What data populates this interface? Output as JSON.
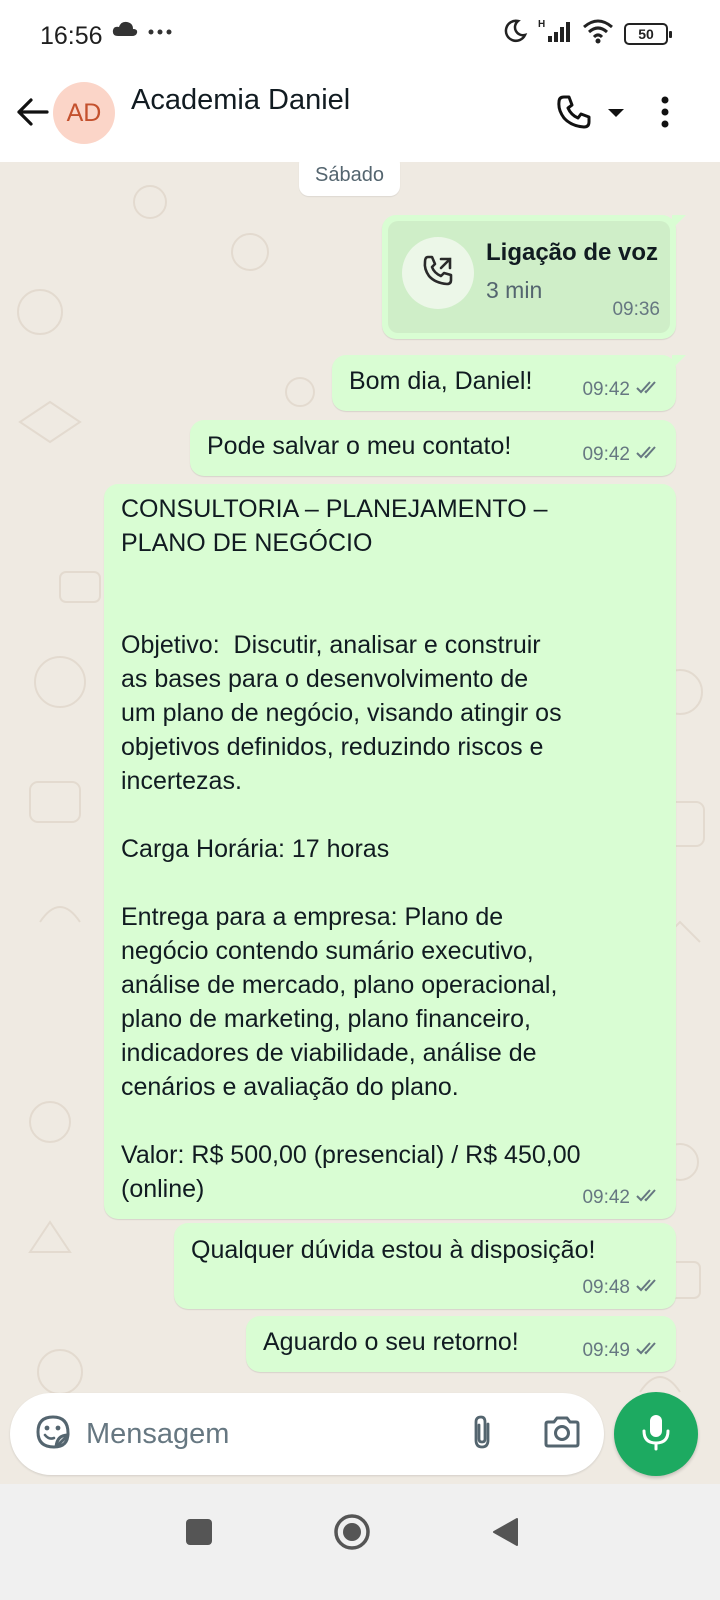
{
  "status_bar": {
    "time": "16:56",
    "left_icons": [
      "cloud-icon",
      "more-dots-icon"
    ],
    "right_icons": [
      "moon-icon",
      "signal-icon",
      "wifi-icon",
      "battery-icon"
    ],
    "battery_level": "50"
  },
  "header": {
    "avatar_initials": "AD",
    "contact_name": "Academia Daniel",
    "icons": [
      "back-arrow-icon",
      "phone-icon",
      "dropdown-icon",
      "more-vert-icon"
    ]
  },
  "chat": {
    "date_label": "Sábado",
    "voice_call": {
      "title": "Ligação de voz",
      "duration": "3 min",
      "time": "09:36"
    },
    "messages": [
      {
        "text": "Bom dia, Daniel!",
        "time": "09:42",
        "status": "read"
      },
      {
        "text": "Pode salvar o meu contato!",
        "time": "09:42",
        "status": "read"
      },
      {
        "text": "CONSULTORIA – PLANEJAMENTO –\nPLANO DE NEGÓCIO\n\n\nObjetivo:  Discutir, analisar e construir\nas bases para o desenvolvimento de\num plano de negócio, visando atingir os\nobjetivos definidos, reduzindo riscos e\nincertezas.\n\nCarga Horária: 17 horas\n\nEntrega para a empresa: Plano de\nnegócio contendo sumário executivo,\nanálise de mercado, plano operacional,\nplano de marketing, plano financeiro,\nindicadores de viabilidade, análise de\ncenários e avaliação do plano.\n\nValor: R$ 500,00 (presencial) / R$ 450,00\n(online)",
        "time": "09:42",
        "status": "read"
      },
      {
        "text": "Qualquer dúvida estou à disposição!",
        "time": "09:48",
        "status": "read"
      },
      {
        "text": "Aguardo o seu retorno!",
        "time": "09:49",
        "status": "read"
      }
    ]
  },
  "composer": {
    "placeholder": "Mensagem",
    "icons": [
      "emoji-sticker-icon",
      "attach-icon",
      "camera-icon",
      "mic-icon"
    ]
  },
  "nav_bar": {
    "icons": [
      "recents-square-icon",
      "home-circle-icon",
      "back-triangle-icon"
    ]
  },
  "colors": {
    "outgoing_bubble": "#d9fdd3",
    "chat_background": "#efeae2",
    "accent_green": "#1daa61",
    "read_ticks": "#667781"
  }
}
